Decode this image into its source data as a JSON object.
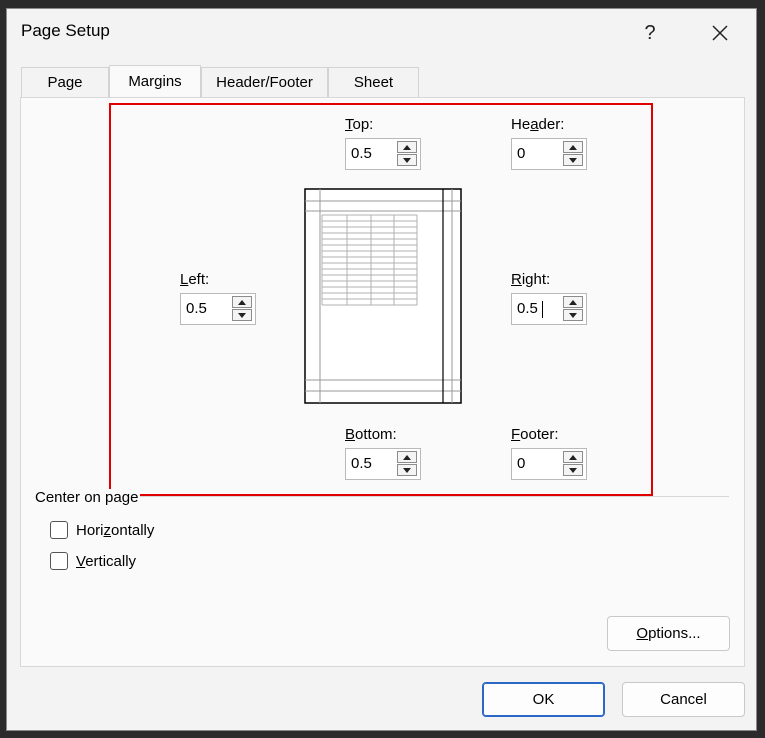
{
  "dialog": {
    "title": "Page Setup",
    "help": "?",
    "close": "✕"
  },
  "tabs": [
    {
      "label": "Page"
    },
    {
      "label": "Margins"
    },
    {
      "label": "Header/Footer"
    },
    {
      "label": "Sheet"
    }
  ],
  "margins": {
    "top": {
      "label_pre": "",
      "label_ul": "T",
      "label_post": "op:",
      "value": "0.5"
    },
    "header": {
      "label_pre": "He",
      "label_ul": "a",
      "label_post": "der:",
      "value": "0"
    },
    "left": {
      "label_pre": "",
      "label_ul": "L",
      "label_post": "eft:",
      "value": "0.5"
    },
    "right": {
      "label_pre": "",
      "label_ul": "R",
      "label_post": "ight:",
      "value": "0.5"
    },
    "bottom": {
      "label_pre": "",
      "label_ul": "B",
      "label_post": "ottom:",
      "value": "0.5"
    },
    "footer": {
      "label_pre": "",
      "label_ul": "F",
      "label_post": "ooter:",
      "value": "0"
    }
  },
  "center": {
    "title": "Center on page",
    "horizontally": {
      "pre": "Hori",
      "ul": "z",
      "post": "ontally"
    },
    "vertically": {
      "pre": "",
      "ul": "V",
      "post": "ertically"
    }
  },
  "buttons": {
    "options": {
      "ul": "O",
      "post": "ptions..."
    },
    "ok": "OK",
    "cancel": "Cancel"
  },
  "colors": {
    "highlight_box": "#e00000",
    "primary_border": "#2b68c5"
  }
}
